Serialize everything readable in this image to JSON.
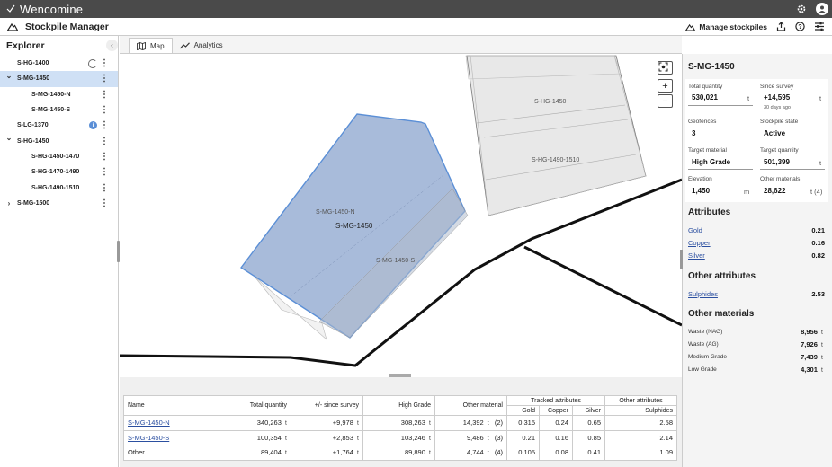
{
  "app": {
    "name": "Wencomine",
    "title": "Stockpile Manager",
    "manage_label": "Manage stockpiles"
  },
  "sidebar": {
    "header": "Explorer",
    "items": [
      {
        "label": "S-HG-1400",
        "indent": 0,
        "chev": "",
        "status": "spinner"
      },
      {
        "label": "S-MG-1450",
        "indent": 0,
        "chev": "down",
        "selected": true
      },
      {
        "label": "S-MG-1450-N",
        "indent": 1
      },
      {
        "label": "S-MG-1450-S",
        "indent": 1
      },
      {
        "label": "S-LG-1370",
        "indent": 0,
        "status": "info"
      },
      {
        "label": "S-HG-1450",
        "indent": 0,
        "chev": "down"
      },
      {
        "label": "S-HG-1450-1470",
        "indent": 1
      },
      {
        "label": "S-HG-1470-1490",
        "indent": 1
      },
      {
        "label": "S-HG-1490-1510",
        "indent": 1
      },
      {
        "label": "S-MG-1500",
        "indent": 0,
        "chev": "right"
      }
    ]
  },
  "tabs": [
    {
      "label": "Map",
      "active": true
    },
    {
      "label": "Analytics",
      "active": false
    }
  ],
  "map": {
    "labels": {
      "s_hg_1450": "S-HG-1450",
      "s_hg_1490_1510": "S-HG-1490-1510",
      "s_mg_1450_n": "S-MG-1450-N",
      "s_mg_1450": "S-MG-1450",
      "s_mg_1450_s": "S-MG-1450-S"
    },
    "zoom_in": "+",
    "zoom_out": "−"
  },
  "table": {
    "headers": {
      "name": "Name",
      "total": "Total quantity",
      "since": "+/- since survey",
      "high": "High Grade",
      "other": "Other material",
      "tracked": "Tracked attributes",
      "other_attr": "Other attributes",
      "gold": "Gold",
      "copper": "Copper",
      "silver": "Silver",
      "sulphides": "Sulphides"
    },
    "unit": "t",
    "rows": [
      {
        "name": "S-MG-1450-N",
        "link": true,
        "total": "340,263",
        "since": "+9,978",
        "high": "308,263",
        "other": "14,392",
        "other_count": "(2)",
        "gold": "0.315",
        "copper": "0.24",
        "silver": "0.65",
        "sulphides": "2.58"
      },
      {
        "name": "S-MG-1450-S",
        "link": true,
        "total": "100,354",
        "since": "+2,853",
        "high": "103,246",
        "other": "9,486",
        "other_count": "(3)",
        "gold": "0.21",
        "copper": "0.16",
        "silver": "0.85",
        "sulphides": "2.14"
      },
      {
        "name": "Other",
        "link": false,
        "total": "89,404",
        "since": "+1,764",
        "high": "89,890",
        "other": "4,744",
        "other_count": "(4)",
        "gold": "0.105",
        "copper": "0.08",
        "silver": "0.41",
        "sulphides": "1.09"
      }
    ]
  },
  "panel": {
    "title": "S-MG-1450",
    "total_quantity": {
      "label": "Total quantity",
      "value": "530,021",
      "unit": "t"
    },
    "since_survey": {
      "label": "Since survey",
      "value": "+14,595",
      "unit": "t",
      "sub": "30 days ago"
    },
    "geofences": {
      "label": "Geofences",
      "value": "3"
    },
    "stockpile_state": {
      "label": "Stockpile state",
      "value": "Active"
    },
    "target_material": {
      "label": "Target material",
      "value": "High Grade"
    },
    "target_quantity": {
      "label": "Target quantity",
      "value": "501,399",
      "unit": "t"
    },
    "elevation": {
      "label": "Elevation",
      "value": "1,450",
      "unit": "m"
    },
    "other_materials_kv": {
      "label": "Other materials",
      "value": "28,622",
      "unit": "t (4)"
    },
    "attributes_title": "Attributes",
    "attributes": [
      {
        "label": "Gold",
        "value": "0.21"
      },
      {
        "label": "Copper",
        "value": "0.16"
      },
      {
        "label": "Silver",
        "value": "0.82"
      }
    ],
    "other_attributes_title": "Other attributes",
    "other_attributes": [
      {
        "label": "Sulphides",
        "value": "2.53"
      }
    ],
    "other_materials_title": "Other materials",
    "other_materials": [
      {
        "label": "Waste (NAG)",
        "value": "8,956",
        "unit": "t"
      },
      {
        "label": "Waste (AG)",
        "value": "7,926",
        "unit": "t"
      },
      {
        "label": "Medium Grade",
        "value": "7,439",
        "unit": "t"
      },
      {
        "label": "Low Grade",
        "value": "4,301",
        "unit": "t"
      }
    ]
  }
}
